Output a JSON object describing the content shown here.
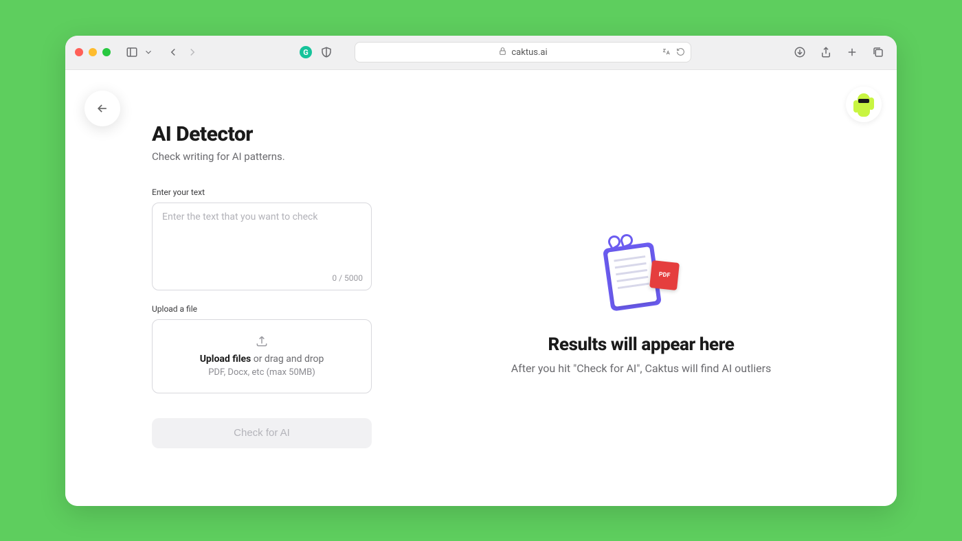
{
  "browser": {
    "url": "caktus.ai"
  },
  "page": {
    "title": "AI Detector",
    "subtitle": "Check writing for AI patterns.",
    "text_label": "Enter your text",
    "text_placeholder": "Enter the text that you want to check",
    "counter": "0 / 5000",
    "upload_label": "Upload a file",
    "upload_strong": "Upload files",
    "upload_rest": " or drag and drop",
    "upload_hint": "PDF, Docx, etc (max 50MB)",
    "check_button": "Check for AI",
    "results_title": "Results will appear here",
    "results_sub": "After you hit \"Check for AI\", Caktus will find AI outliers",
    "pdf_badge": "PDF"
  }
}
